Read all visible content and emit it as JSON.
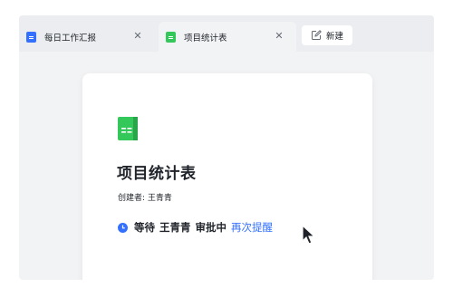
{
  "tabs": [
    {
      "label": "每日工作汇报",
      "icon": "doc-icon",
      "active": false
    },
    {
      "label": "项目统计表",
      "icon": "sheet-icon",
      "active": true
    }
  ],
  "new_tab": {
    "label": "新建",
    "icon": "edit-icon"
  },
  "card": {
    "icon": "sheet-icon",
    "title": "项目统计表",
    "creator": "创建者: 王青青",
    "status_icon": "clock-icon",
    "status_wait": "等待",
    "status_name": "王青青",
    "status_state": "审批中",
    "remind_label": "再次提醒"
  },
  "colors": {
    "accent": "#3370ff",
    "sheet_green": "#34c759"
  }
}
